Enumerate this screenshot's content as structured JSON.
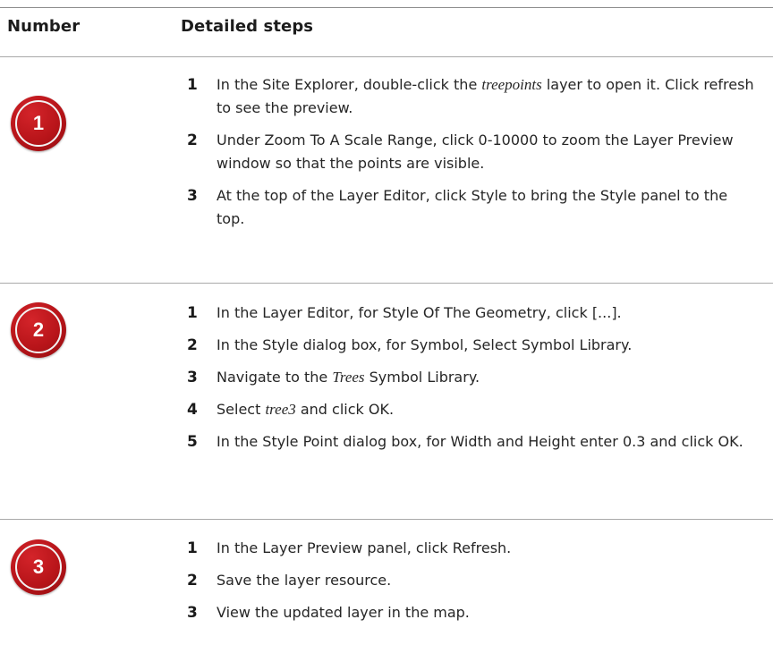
{
  "header": {
    "number_label": "Number",
    "steps_label": "Detailed steps"
  },
  "rows": [
    {
      "badge": "1",
      "steps": [
        {
          "n": "1",
          "parts": [
            {
              "text": "In the Site Explorer, double-click the "
            },
            {
              "text": "treepoints",
              "italic": true
            },
            {
              "text": " layer to open it. Click refresh to see the preview."
            }
          ]
        },
        {
          "n": "2",
          "parts": [
            {
              "text": "Under Zoom To A Scale Range, click 0-10000 to zoom the Layer Preview window so that the points are visible."
            }
          ]
        },
        {
          "n": "3",
          "parts": [
            {
              "text": "At the top of the Layer Editor, click Style to bring the Style panel to the top."
            }
          ]
        }
      ]
    },
    {
      "badge": "2",
      "steps": [
        {
          "n": "1",
          "parts": [
            {
              "text": "In the Layer Editor, for Style Of The Geometry, click [...]."
            }
          ]
        },
        {
          "n": "2",
          "parts": [
            {
              "text": "In the Style dialog box, for Symbol, Select Symbol Library."
            }
          ]
        },
        {
          "n": "3",
          "parts": [
            {
              "text": "Navigate to the "
            },
            {
              "text": "Trees",
              "italic": true
            },
            {
              "text": " Symbol Library."
            }
          ]
        },
        {
          "n": "4",
          "parts": [
            {
              "text": "Select "
            },
            {
              "text": "tree3",
              "italic": true
            },
            {
              "text": " and click OK."
            }
          ]
        },
        {
          "n": "5",
          "parts": [
            {
              "text": "In the Style Point dialog box, for Width and Height enter 0.3 and click OK."
            }
          ]
        }
      ]
    },
    {
      "badge": "3",
      "steps": [
        {
          "n": "1",
          "parts": [
            {
              "text": "In the Layer Preview panel, click Refresh."
            }
          ]
        },
        {
          "n": "2",
          "parts": [
            {
              "text": "Save the layer resource."
            }
          ]
        },
        {
          "n": "3",
          "parts": [
            {
              "text": "View the updated layer in the map."
            }
          ]
        }
      ]
    }
  ],
  "colors": {
    "badge_red": "#b71419",
    "rule_gray": "#a9a9a9",
    "text": "#262626"
  }
}
